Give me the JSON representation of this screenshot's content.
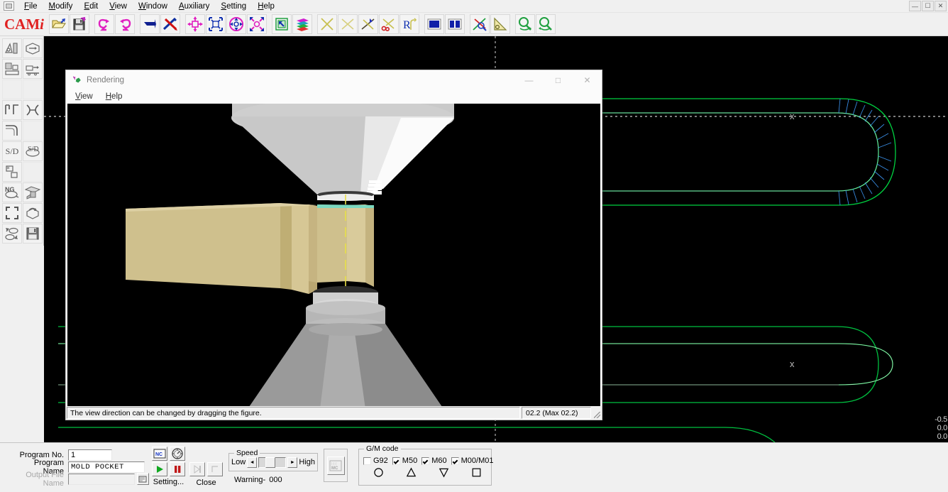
{
  "app": {
    "logo": "CAM",
    "logo_italic": "i"
  },
  "menubar": {
    "items": [
      {
        "name": "file",
        "label": "File",
        "accel": "F"
      },
      {
        "name": "modify",
        "label": "Modify",
        "accel": "M"
      },
      {
        "name": "edit",
        "label": "Edit",
        "accel": "E"
      },
      {
        "name": "view",
        "label": "View",
        "accel": "V"
      },
      {
        "name": "window",
        "label": "Window",
        "accel": "W"
      },
      {
        "name": "auxiliary",
        "label": "Auxiliary",
        "accel": "A"
      },
      {
        "name": "setting",
        "label": "Setting",
        "accel": "S"
      },
      {
        "name": "help",
        "label": "Help",
        "accel": "H"
      }
    ],
    "window_controls": [
      "minimize",
      "maximize",
      "close"
    ]
  },
  "toolbar": {
    "buttons": [
      "open-folder-icon",
      "save-disk-icon",
      "undo-icon",
      "redo-icon",
      "pointer-arrow-icon",
      "pen-tools-icon",
      "move-icon",
      "scale-icon",
      "rotate-icon",
      "shrink-icon",
      "copy-icon",
      "layers-icon",
      "delete-line-icon",
      "trim-line-icon",
      "extend-line-icon",
      "cut-scissors-icon",
      "radius-corner-icon",
      "fill-solid-icon",
      "split-view-icon",
      "measure-angle-icon",
      "triangle-ruler-icon",
      "zoom-in-icon",
      "zoom-out-icon"
    ]
  },
  "sidebar": {
    "buttons": [
      "turning-tool-icon",
      "solid-rotate-icon",
      "setup-stock-icon",
      "transfer-stock-icon",
      "blank-1",
      "blank-2",
      "corner-shape-icon",
      "cross-path-icon",
      "curve-step-icon",
      "blank-3",
      "sd-text-icon",
      "sd-solid-icon",
      "pocket-icon",
      "blank-4",
      "ng-check-icon",
      "machine-icon",
      "fit-extent-icon",
      "rotate-solid-icon",
      "swap-shapes-icon",
      "save-floppy-icon"
    ],
    "sd_label": "S/D",
    "ng_label": "NG"
  },
  "cad_view": {
    "background_color": "#000000",
    "wireframe_color": "#00c040",
    "hatch_color": "#2a7fff",
    "centerline_color": "#c8c8c8",
    "marker": "x",
    "coordinates": [
      "-0.5",
      "0.0",
      "0.0"
    ]
  },
  "rendering_dialog": {
    "title": "Rendering",
    "icon": "render-gem-icon",
    "menus": [
      {
        "name": "view",
        "label": "View",
        "accel": "V"
      },
      {
        "name": "help",
        "label": "Help",
        "accel": "H"
      }
    ],
    "window_controls": [
      {
        "name": "minimize",
        "glyph": "—"
      },
      {
        "name": "maximize",
        "glyph": "□"
      },
      {
        "name": "close",
        "glyph": "✕"
      }
    ],
    "status_message": "The view direction can be changed by dragging the figure.",
    "progress_text": "02.2 (Max 02.2)"
  },
  "bottom_panel": {
    "program_no_label": "Program No.",
    "program_no_value": "1",
    "program_name_label": "Program Name",
    "program_name_value": "MOLD  POCKET",
    "output_file_label": "Output File Name",
    "output_file_value": "",
    "browse_button": "browse-file-icon",
    "nc_button": "nc-code-icon",
    "dial_button": "speed-dial-icon",
    "play_button": "play-icon",
    "pause_button": "pause-icon",
    "step_button": "step-forward-icon",
    "stop_button": "stop-icon",
    "setting_button": "Setting...",
    "close_button": "Close",
    "mc_button": "mc-icon",
    "speed": {
      "title": "Speed",
      "low_label": "Low",
      "high_label": "High",
      "left_arrow": "◄",
      "right_arrow": "►",
      "value_position": 0.42
    },
    "warning_label": "Warning-",
    "warning_value": "000",
    "gm_code": {
      "title": "G/M code",
      "items": [
        {
          "name": "g92",
          "label": "G92",
          "checked": false,
          "shape": "circle"
        },
        {
          "name": "m50",
          "label": "M50",
          "checked": true,
          "shape": "triangle-up"
        },
        {
          "name": "m60",
          "label": "M60",
          "checked": true,
          "shape": "triangle-down"
        },
        {
          "name": "m00-m01",
          "label": "M00/M01",
          "checked": true,
          "shape": "square"
        }
      ]
    }
  }
}
